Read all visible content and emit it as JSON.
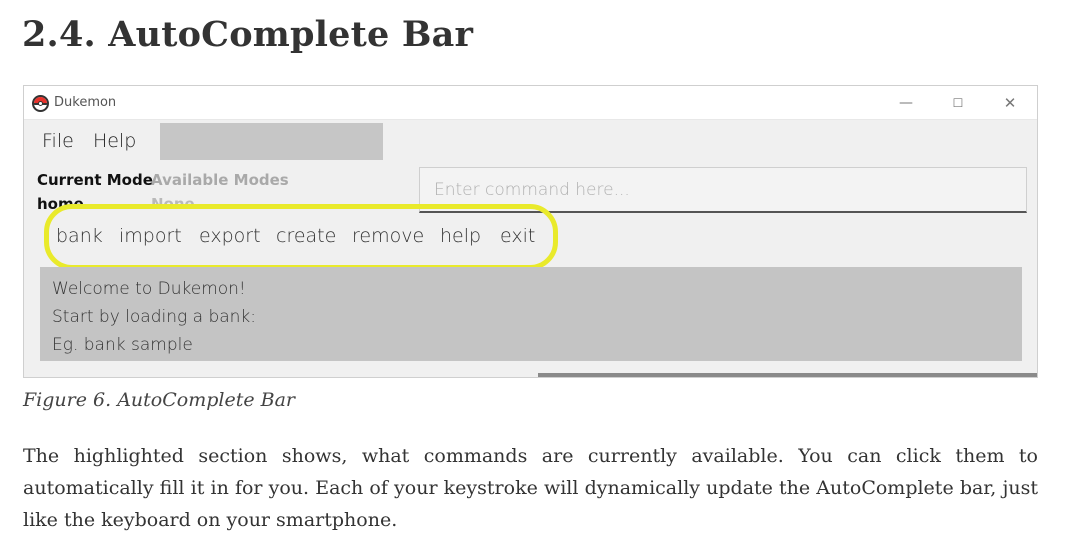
{
  "section_heading": "2.4. AutoComplete Bar",
  "window": {
    "title": "Dukemon",
    "controls": {
      "minimize": "—",
      "maximize": "☐",
      "close": "✕"
    }
  },
  "menu": {
    "file_label": "File",
    "help_label": "Help"
  },
  "modes": {
    "current_label": "Current Mode",
    "current_value": "home",
    "available_label": "Available Modes",
    "available_value": "None"
  },
  "command_input": {
    "placeholder": "Enter command here..."
  },
  "autocomplete": {
    "commands": [
      "bank",
      "import",
      "export",
      "create",
      "remove",
      "help",
      "exit"
    ]
  },
  "welcome_lines": [
    "Welcome to Dukemon!",
    "Start by loading a bank:",
    "Eg. bank sample"
  ],
  "figure_caption": "Figure 6. AutoComplete Bar",
  "description": "The highlighted section shows, what commands are currently available. You can click them to automatically fill it in for you. Each of your keystroke will dynamically update the AutoComplete bar, just like the keyboard on your smartphone.",
  "colors": {
    "highlight": "#e9ea2b",
    "panel": "#c4c4c4",
    "icon_red": "#e8322b"
  }
}
